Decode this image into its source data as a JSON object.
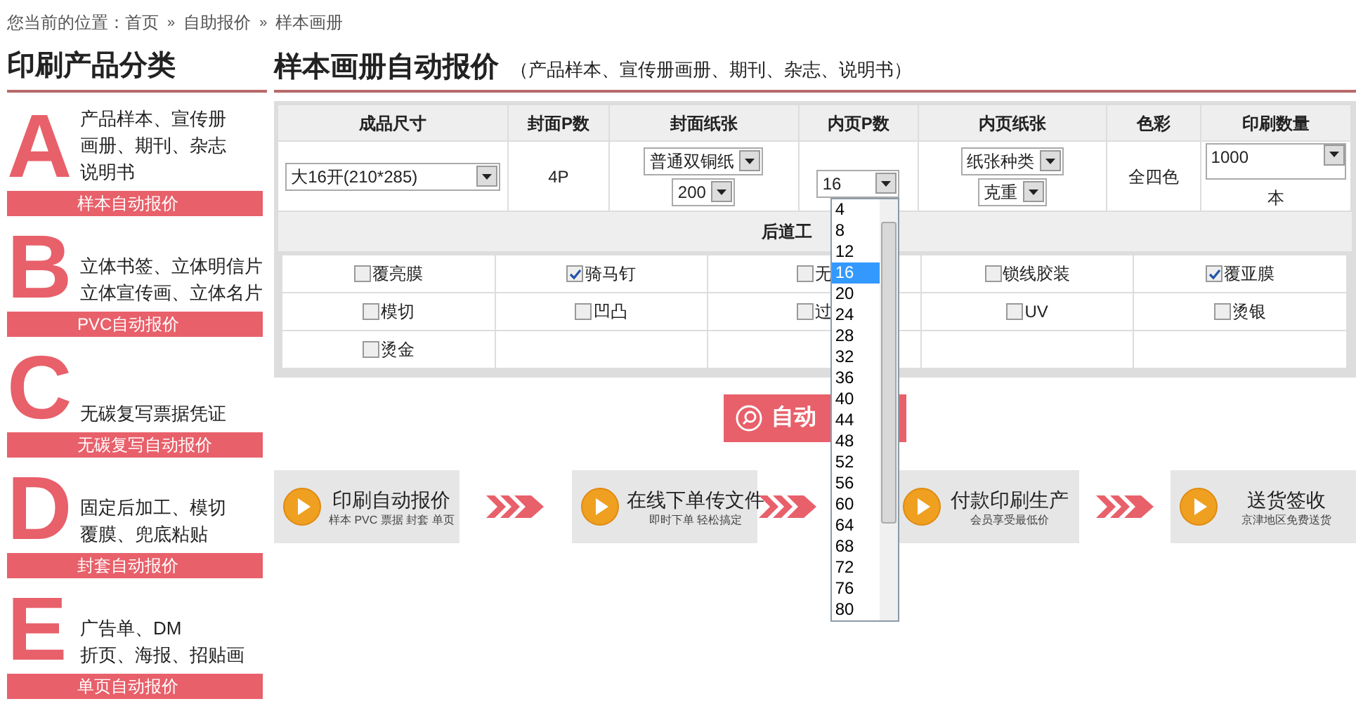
{
  "breadcrumb": [
    {
      "kind": "label",
      "text": "您当前的位置："
    },
    {
      "kind": "link",
      "text": "首页"
    },
    {
      "kind": "sep",
      "text": "»"
    },
    {
      "kind": "link",
      "text": "自助报价"
    },
    {
      "kind": "sep",
      "text": "»"
    },
    {
      "kind": "link",
      "text": "样本画册"
    }
  ],
  "sidebar": {
    "title": "印刷产品分类",
    "categories": [
      {
        "letter": "A",
        "lines": [
          "产品样本、宣传册",
          "画册、期刊、杂志",
          "说明书"
        ],
        "link": "样本自动报价"
      },
      {
        "letter": "B",
        "lines": [
          "立体书签、立体明信片",
          "立体宣传画、立体名片"
        ],
        "link": "PVC自动报价"
      },
      {
        "letter": "C",
        "lines": [
          "无碳复写票据凭证"
        ],
        "link": "无碳复写自动报价"
      },
      {
        "letter": "D",
        "lines": [
          "固定后加工、模切",
          "覆膜、兜底粘贴"
        ],
        "link": "封套自动报价"
      },
      {
        "letter": "E",
        "lines": [
          "广告单、DM",
          "折页、海报、招贴画"
        ],
        "link": "单页自动报价"
      }
    ]
  },
  "main": {
    "title": "样本画册自动报价",
    "subtitle": "（产品样本、宣传册画册、期刊、杂志、说明书）",
    "columns": [
      "成品尺寸",
      "封面P数",
      "封面纸张",
      "内页P数",
      "内页纸张",
      "色彩",
      "印刷数量"
    ],
    "row": [
      {
        "kind": "select",
        "value": "大16开(210*285)"
      },
      {
        "kind": "text",
        "text": "4P"
      },
      {
        "kind": "selects",
        "selects": [
          "普通双铜纸",
          "200"
        ]
      },
      {
        "kind": "open_select",
        "value": "16",
        "options": [
          {
            "label": "4",
            "selected": false
          },
          {
            "label": "8",
            "selected": false
          },
          {
            "label": "12",
            "selected": false
          },
          {
            "label": "16",
            "selected": true
          },
          {
            "label": "20",
            "selected": false
          },
          {
            "label": "24",
            "selected": false
          },
          {
            "label": "28",
            "selected": false
          },
          {
            "label": "32",
            "selected": false
          },
          {
            "label": "36",
            "selected": false
          },
          {
            "label": "40",
            "selected": false
          },
          {
            "label": "44",
            "selected": false
          },
          {
            "label": "48",
            "selected": false
          },
          {
            "label": "52",
            "selected": false
          },
          {
            "label": "56",
            "selected": false
          },
          {
            "label": "60",
            "selected": false
          },
          {
            "label": "64",
            "selected": false
          },
          {
            "label": "68",
            "selected": false
          },
          {
            "label": "72",
            "selected": false
          },
          {
            "label": "76",
            "selected": false
          },
          {
            "label": "80",
            "selected": false
          }
        ]
      },
      {
        "kind": "selects",
        "selects": [
          "纸张种类",
          "克重"
        ]
      },
      {
        "kind": "text",
        "text": "全四色"
      },
      {
        "kind": "quantity",
        "value": "1000",
        "unit": "本"
      }
    ],
    "section_title": "后道工",
    "finishing": [
      {
        "label": "覆亮膜",
        "checked": false
      },
      {
        "label": "骑马钉",
        "checked": true
      },
      {
        "label": "无",
        "checked": false
      },
      {
        "label": "锁线胶装",
        "checked": false
      },
      {
        "label": "覆亚膜",
        "checked": true
      },
      {
        "label": "模切",
        "checked": false
      },
      {
        "label": "凹凸",
        "checked": false
      },
      {
        "label": "过",
        "checked": false
      },
      {
        "label": "UV",
        "checked": false
      },
      {
        "label": "烫银",
        "checked": false
      },
      {
        "label": "烫金",
        "checked": false
      }
    ],
    "quote_button": "自动",
    "steps": [
      {
        "title": "印刷自动报价",
        "subtitle": "样本 PVC 票据 封套 单页"
      },
      {
        "title": "在线下单传文件",
        "subtitle": "即时下单 轻松搞定"
      },
      {
        "title": "付款印刷生产",
        "subtitle": "会员享受最低价"
      },
      {
        "title": "送货签收",
        "subtitle": "京津地区免费送货"
      }
    ]
  }
}
